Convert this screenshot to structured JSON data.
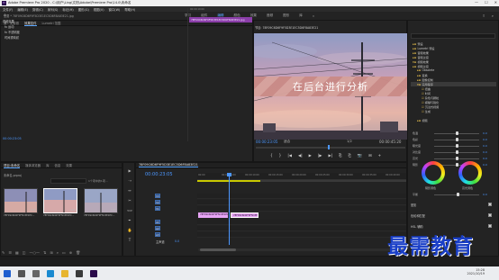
{
  "window": {
    "title": "Adobe Premiere Pro 2020 - C:\\用户\\Ling\\文档\\Adobe\\Premiere Pro\\14.0\\未命名",
    "controls": [
      "—",
      "☐",
      "✕"
    ]
  },
  "menu": [
    "文件(F)",
    "编辑(E)",
    "剪辑(C)",
    "序列(S)",
    "标记(M)",
    "图形(G)",
    "视图(V)",
    "窗口(W)",
    "帮助(H)"
  ],
  "workspaces": {
    "items": [
      "学习",
      "组件",
      "编辑",
      "颜色",
      "效果",
      "音频",
      "图形",
      "库",
      "»"
    ],
    "active": "编辑"
  },
  "effect_controls": {
    "tabs": [
      "源：无剪辑",
      "效果控件",
      "Lumetri 范围"
    ],
    "active_tab": "效果控件",
    "source_line": "主要 * 78F09C6D6F9F5D3E1EC5D6F8A83E21.jpg",
    "clip_line": "78F09C6D6F9F5D3E1EC5D6F8A83E21.jpg",
    "section_video": "视频效果",
    "effects": [
      "fx 运动",
      "fx 不透明度",
      "时间重映射"
    ],
    "ruler_time": "00:00:10:00",
    "clip_label": "78F09C6D6F9F5D3E1EC5D6F8A83E21.jpg",
    "timecode": "00:00:23:05"
  },
  "program_monitor": {
    "title": "节目: 78F09C6D6F9F5D3E1EC5D6F8A83E21",
    "overlay_text": "在后台进行分析",
    "timecode_left": "00:00:23:05",
    "fit": "适合",
    "quality": "1/2",
    "timecode_right": "00:00:45:20",
    "transport": [
      "{",
      "}",
      "|◀",
      "◀|",
      "▶",
      "|▶",
      "▶|",
      "⎘",
      "⎗",
      "📷",
      "⊞",
      "+"
    ]
  },
  "project": {
    "tabs": [
      "项目:未命名",
      "媒体浏览器",
      "库",
      "信息",
      "效果"
    ],
    "active_tab": "项目:未命名",
    "file": "未命名.prproj",
    "search_placeholder": "",
    "count": "1个项中的1项...",
    "items": [
      {
        "label": "78F09C6D6F9F5D3E1EC...",
        "duration": "5:00"
      },
      {
        "label": "78F09C6D6F9F5D3E1EC...",
        "duration": "5:00"
      },
      {
        "label": "78F09C6D6F9F5D3E1EC...",
        "duration": "5:00"
      }
    ],
    "bottom_icons": [
      "pencil-icon",
      "list-view-icon",
      "icon-view-icon",
      "freeform-view-icon",
      "zoom-slider",
      "sort-icon",
      "automate-icon",
      "search-icon",
      "new-bin-icon",
      "new-item-icon",
      "delete-icon"
    ]
  },
  "tools": [
    "▶",
    "⇢",
    "↔",
    "✂",
    "⟺",
    "✒",
    "✋",
    "T"
  ],
  "timeline": {
    "sequence": "78F09C6D6F9F5D3E1EC5D6F8A83E21",
    "timecode": "00:00:23:05",
    "ruler_ticks": [
      "00:00",
      "00:00:05:00",
      "00:00:10:00",
      "00:00:15:00",
      "00:00:20:00",
      "00:00:25:00",
      "00:00:30:00",
      "00:00:35:00",
      "00:00:40:00"
    ],
    "tracks": [
      "V3",
      "V2",
      "V1",
      "A1",
      "A2",
      "A3",
      "主声道"
    ],
    "master_value": "0.0",
    "clips": [
      {
        "label": "78F09C6D6F9F5D3E1EC...jpg"
      },
      {
        "label": "78F09C6D6F9F5D3E1EC...jpg"
      }
    ]
  },
  "lumetri": {
    "search_placeholder": "",
    "tree": [
      {
        "label": "预设",
        "level": 0
      },
      {
        "label": "Lumetri 预设",
        "level": 0
      },
      {
        "label": "音频效果",
        "level": 0
      },
      {
        "label": "音频过渡",
        "level": 0
      },
      {
        "label": "视频效果",
        "level": 0
      },
      {
        "label": "视频过渡",
        "level": 0
      },
      {
        "label": "Obsolete",
        "level": 1
      },
      {
        "label": "变换",
        "level": 1
      },
      {
        "label": "图像控制",
        "level": 1
      },
      {
        "label": "实用程序",
        "level": 1
      },
      {
        "label": "扭曲",
        "level": 1
      },
      {
        "label": "时间",
        "level": 1
      },
      {
        "label": "杂色与颗粒",
        "level": 1
      },
      {
        "label": "模糊与锐化",
        "level": 1
      },
      {
        "label": "沉浸式视频",
        "level": 1
      },
      {
        "label": "生成",
        "level": 1
      },
      {
        "label": "视频",
        "level": 1
      }
    ],
    "selected": "视频效果",
    "sliders": [
      {
        "label": "色温",
        "value": "0.0",
        "pos": 0.5
      },
      {
        "label": "色彩",
        "value": "0.0",
        "pos": 0.5
      },
      {
        "label": "曝光度",
        "value": "0.0",
        "pos": 0.5
      },
      {
        "label": "对比度",
        "value": "0.0",
        "pos": 0.5
      },
      {
        "label": "高光",
        "value": "0.0",
        "pos": 0.5
      },
      {
        "label": "阴影",
        "value": "0.0",
        "pos": 0.5
      }
    ],
    "wheels": [
      "阴影调色",
      "高光调色"
    ],
    "wheel_balance": "平衡",
    "balance_value": "0.0",
    "checks": [
      "晕影",
      "色轮和匹配",
      "HSL 辅助",
      "Lumetri 颜色"
    ]
  },
  "watermark": "最需教育",
  "taskbar": {
    "time": "15:28",
    "date": "2021/10/19",
    "icons": [
      {
        "name": "windows-start-icon",
        "color": "#1f5fcf"
      },
      {
        "name": "search-icon",
        "color": "#555555"
      },
      {
        "name": "task-view-icon",
        "color": "#666666"
      },
      {
        "name": "edge-icon",
        "color": "#1a8ad0"
      },
      {
        "name": "file-explorer-icon",
        "color": "#e7b530"
      },
      {
        "name": "store-icon",
        "color": "#3a3a3a"
      },
      {
        "name": "premiere-icon",
        "color": "#2a0a4a"
      }
    ]
  }
}
